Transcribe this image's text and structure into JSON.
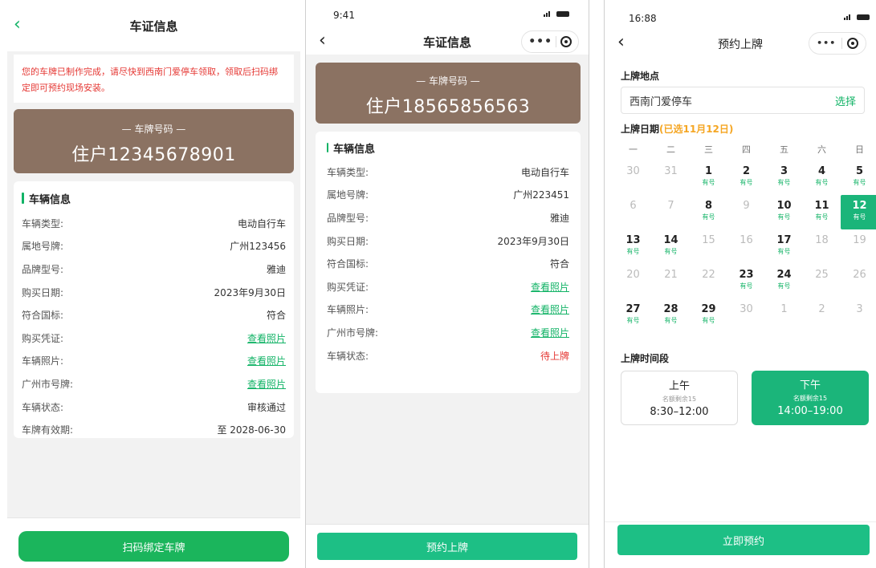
{
  "screen1": {
    "title": "车证信息",
    "notice": "您的车牌已制作完成，请尽快到西南门爱停车领取，领取后扫码绑定即可预约现场安装。",
    "plate_label": "— 车牌号码 —",
    "plate_number": "住户12345678901",
    "section_title": "车辆信息",
    "rows": [
      {
        "key": "车辆类型:",
        "value": "电动自行车"
      },
      {
        "key": "属地号牌:",
        "value": "广州123456"
      },
      {
        "key": "品牌型号:",
        "value": "雅迪"
      },
      {
        "key": "购买日期:",
        "value": "2023年9月30日"
      },
      {
        "key": "符合国标:",
        "value": "符合"
      },
      {
        "key": "购买凭证:",
        "value": "查看照片"
      },
      {
        "key": "车辆照片:",
        "value": "查看照片"
      },
      {
        "key": "广州市号牌:",
        "value": "查看照片"
      },
      {
        "key": "车辆状态:",
        "value": "审核通过"
      },
      {
        "key": "车牌有效期:",
        "value": "至 2028-06-30"
      }
    ],
    "button": "扫码绑定车牌"
  },
  "screen2": {
    "time": "9:41",
    "title": "车证信息",
    "plate_label": "— 车牌号码 —",
    "plate_number": "住户18565856563",
    "section_title": "车辆信息",
    "rows": [
      {
        "key": "车辆类型:",
        "value": "电动自行车"
      },
      {
        "key": "属地号牌:",
        "value": "广州223451"
      },
      {
        "key": "品牌型号:",
        "value": "雅迪"
      },
      {
        "key": "购买日期:",
        "value": "2023年9月30日"
      },
      {
        "key": "符合国标:",
        "value": "符合"
      },
      {
        "key": "购买凭证:",
        "value": "查看照片"
      },
      {
        "key": "车辆照片:",
        "value": "查看照片"
      },
      {
        "key": "广州市号牌:",
        "value": "查看照片"
      },
      {
        "key": "车辆状态:",
        "value": "待上牌"
      }
    ],
    "button": "预约上牌"
  },
  "screen3": {
    "time": "16:88",
    "title": "预约上牌",
    "location_label": "上牌地点",
    "location_value": "西南门爱停车",
    "location_select": "选择",
    "date_label": "上牌日期",
    "date_selected": "(已选11月12日)",
    "weekdays": [
      "一",
      "二",
      "三",
      "四",
      "五",
      "六",
      "日"
    ],
    "availability_label": "有号",
    "days": [
      {
        "d": "30",
        "avail": false
      },
      {
        "d": "31",
        "avail": false
      },
      {
        "d": "1",
        "avail": true
      },
      {
        "d": "2",
        "avail": true
      },
      {
        "d": "3",
        "avail": true
      },
      {
        "d": "4",
        "avail": true
      },
      {
        "d": "5",
        "avail": true
      },
      {
        "d": "6",
        "avail": false
      },
      {
        "d": "7",
        "avail": false
      },
      {
        "d": "8",
        "avail": true
      },
      {
        "d": "9",
        "avail": false
      },
      {
        "d": "10",
        "avail": true
      },
      {
        "d": "11",
        "avail": true
      },
      {
        "d": "12",
        "avail": true,
        "selected": true
      },
      {
        "d": "13",
        "avail": true
      },
      {
        "d": "14",
        "avail": true
      },
      {
        "d": "15",
        "avail": false
      },
      {
        "d": "16",
        "avail": false
      },
      {
        "d": "17",
        "avail": true
      },
      {
        "d": "18",
        "avail": false
      },
      {
        "d": "19",
        "avail": false
      },
      {
        "d": "20",
        "avail": false
      },
      {
        "d": "21",
        "avail": false
      },
      {
        "d": "22",
        "avail": false
      },
      {
        "d": "23",
        "avail": true
      },
      {
        "d": "24",
        "avail": true
      },
      {
        "d": "25",
        "avail": false
      },
      {
        "d": "26",
        "avail": false
      },
      {
        "d": "27",
        "avail": true
      },
      {
        "d": "28",
        "avail": true
      },
      {
        "d": "29",
        "avail": true
      },
      {
        "d": "30",
        "avail": false
      },
      {
        "d": "1",
        "avail": false
      },
      {
        "d": "2",
        "avail": false
      },
      {
        "d": "3",
        "avail": false
      }
    ],
    "time_label": "上牌时间段",
    "slots": [
      {
        "title": "上午",
        "remain": "名额剩余15",
        "range": "8:30–12:00",
        "selected": false
      },
      {
        "title": "下午",
        "remain": "名额剩余15",
        "range": "14:00–19:00",
        "selected": true
      }
    ],
    "button": "立即预约"
  },
  "colors": {
    "accent": "#1bb55c",
    "plate": "#8b7262",
    "warning": "#e53935",
    "highlight": "#f5a623"
  },
  "icons": [
    "back-icon",
    "more-icon",
    "target-icon",
    "signal-icon",
    "battery-icon"
  ]
}
